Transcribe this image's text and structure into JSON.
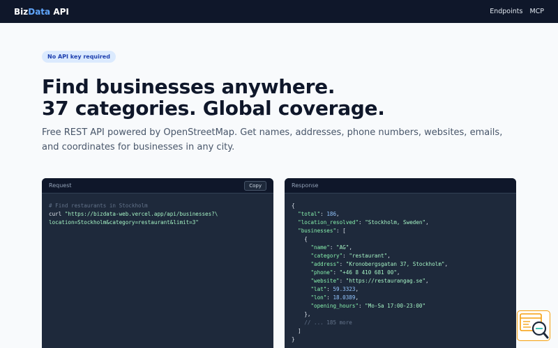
{
  "nav": {
    "brand_prefix": "Biz",
    "brand_accent": "Data",
    "brand_suffix": " API",
    "links": [
      "Endpoints",
      "MCP"
    ]
  },
  "hero": {
    "badge": "No API key required",
    "headline_line1": "Find businesses anywhere.",
    "headline_line2": "37 categories. Global coverage.",
    "subtitle": "Free REST API powered by OpenStreetMap. Get names, addresses, phone numbers, websites, emails, and coordinates for businesses in any city."
  },
  "request": {
    "title": "Request",
    "copy_label": "Copy",
    "comment": "# Find restaurants in Stockholm",
    "cmd": "curl ",
    "url_line1": "\"https://bizdata-web.vercel.app/api/businesses?\\",
    "url_line2": "location=Stockholm&category=restaurant&limit=3\""
  },
  "response": {
    "title": "Response",
    "total_key": "\"total\"",
    "total_val": "186",
    "loc_key": "\"location_resolved\"",
    "loc_val": "\"Stockholm, Sweden\"",
    "biz_key": "\"businesses\"",
    "name_key": "\"name\"",
    "name_val": "\"AG\"",
    "cat_key": "\"category\"",
    "cat_val": "\"restaurant\"",
    "addr_key": "\"address\"",
    "addr_val": "\"Kronobergsgatan 37, Stockholm\"",
    "phone_key": "\"phone\"",
    "phone_val": "\"+46 8 410 681 00\"",
    "web_key": "\"website\"",
    "web_val": "\"https://restaurangag.se\"",
    "lat_key": "\"lat\"",
    "lat_val": "59.3323",
    "lon_key": "\"lon\"",
    "lon_val": "18.0389",
    "hours_key": "\"opening_hours\"",
    "hours_val": "\"Mo-Sa 17:00-23:00\"",
    "more_comment": "// ... 185 more"
  },
  "colors": {
    "nav_bg": "#0f172a",
    "accent": "#60a5fa",
    "panel_bg": "#1e293b",
    "key_green": "#86efac",
    "number_blue": "#93c5fd",
    "widget_border": "#f59e0b"
  },
  "icons": {
    "widget": "code-search-icon"
  }
}
